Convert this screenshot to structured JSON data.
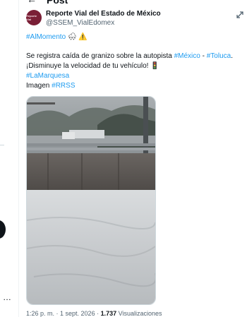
{
  "header": {
    "title": "Post",
    "back_icon": "back-arrow-icon"
  },
  "author": {
    "avatar_text": "Reporte Vial",
    "name": "Reporte Vial del Estado de México",
    "handle": "@SSEM_VialEdomex"
  },
  "tweet": {
    "line1_hashtag": "#AlMomento",
    "line2_prefix": "Se registra caída de granizo sobre la autopista ",
    "line2_hashtag1": "#México",
    "line2_sep": " - ",
    "line2_hashtag2": "#Toluca",
    "line2_suffix": ".",
    "line3": "¡Disminuye la velocidad de tu vehículo! ",
    "line4_hashtag": "#LaMarquesa",
    "line5_prefix": "Imagen ",
    "line5_hashtag": "#RRSS"
  },
  "meta": {
    "time": "1:26 p. m.",
    "sep": " · ",
    "date": "1 sept. 2026",
    "views_count": "1.737",
    "views_label": " Visualizaciones"
  },
  "colors": {
    "link": "#1d9bf0",
    "muted": "#536471",
    "avatar_bg": "#7a1f36"
  }
}
